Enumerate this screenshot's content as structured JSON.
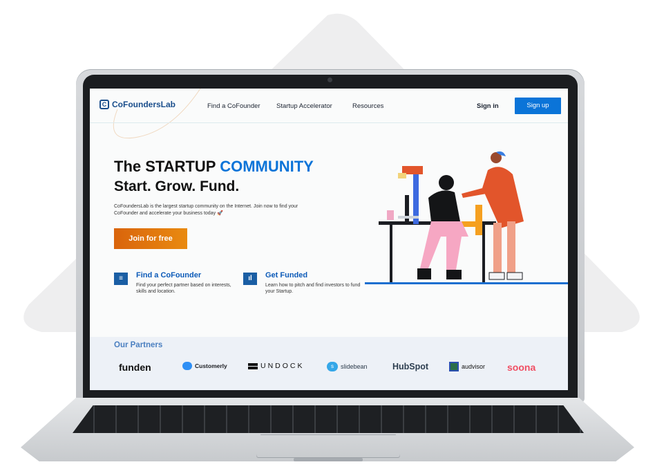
{
  "nav": {
    "logo": "CoFoundersLab",
    "links": [
      "Find a CoFounder",
      "Startup Accelerator",
      "Resources"
    ],
    "sign_in": "Sign in",
    "sign_up": "Sign up"
  },
  "hero": {
    "title_plain": "The STARTUP ",
    "title_accent": "COMMUNITY",
    "subtitle": "Start. Grow. Fund.",
    "lead": "CoFoundersLab is the largest startup community on the Internet. Join now to find your CoFounder and accelerate your business today 🚀",
    "cta": "Join for free"
  },
  "features": [
    {
      "title": "Find a CoFounder",
      "desc": "Find your perfect partner based on interests, skills and location."
    },
    {
      "title": "Get Funded",
      "desc": "Learn how to pitch and find investors to fund your Startup."
    }
  ],
  "partners": {
    "title": "Our Partners",
    "logos": [
      "funden",
      "Customerly",
      "UNDOCK",
      "slidebean",
      "HubSpot",
      "audvisor",
      "soona"
    ]
  },
  "colors": {
    "brand_blue": "#0b74d8",
    "cta_orange": "#e27612",
    "partners_bg": "#edf1f7"
  }
}
